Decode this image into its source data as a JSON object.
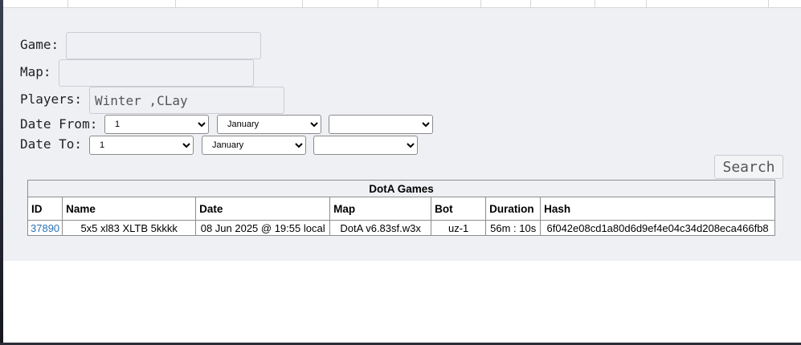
{
  "filters": {
    "game_label": "Game:",
    "game_value": "",
    "map_label": "Map:",
    "map_value": "",
    "players_label": "Players:",
    "players_value": "Winter ,CLay",
    "date_from_label": "Date From:",
    "date_to_label": "Date To:",
    "date_from": {
      "day": "1",
      "month": "January",
      "year": ""
    },
    "date_to": {
      "day": "1",
      "month": "January",
      "year": ""
    },
    "search_label": "Search"
  },
  "table": {
    "caption": "DotA Games",
    "headers": [
      "ID",
      "Name",
      "Date",
      "Map",
      "Bot",
      "Duration",
      "Hash"
    ],
    "rows": [
      [
        "37890",
        "5x5 xl83 XLTB 5kkkk",
        "08 Jun 2025 @ 19:55 local",
        "DotA v6.83sf.w3x",
        "uz-1",
        "56m : 10s",
        "6f042e08cd1a80d6d9ef4e04c34d208eca466fb8"
      ]
    ]
  },
  "colors": {
    "panel": "#eef0f4",
    "link": "#2a70b8"
  }
}
